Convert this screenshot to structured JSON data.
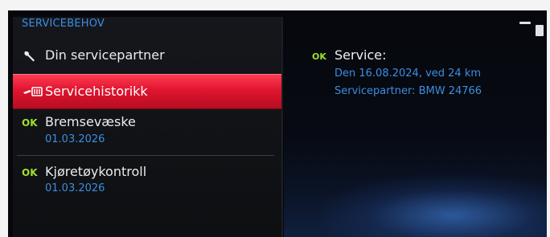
{
  "menu": {
    "title": "SERVICEBEHOV",
    "items": [
      {
        "label": "Din servicepartner",
        "icon": "wrench-icon"
      },
      {
        "label": "Servicehistorikk",
        "icon": "service-history-icon"
      },
      {
        "status": "OK",
        "label": "Bremsevæske",
        "date": "01.03.2026"
      },
      {
        "status": "OK",
        "label": "Kjøretøykontroll",
        "date": "01.03.2026"
      }
    ]
  },
  "detail": {
    "status": "OK",
    "title": "Service:",
    "line1": "Den 16.08.2024, ved 24 km",
    "line2": "Servicepartner: BMW 24766"
  },
  "colors": {
    "accent_blue": "#3d8ee0",
    "ok_green": "#9ee02a",
    "highlight_red": "#e0152f"
  }
}
